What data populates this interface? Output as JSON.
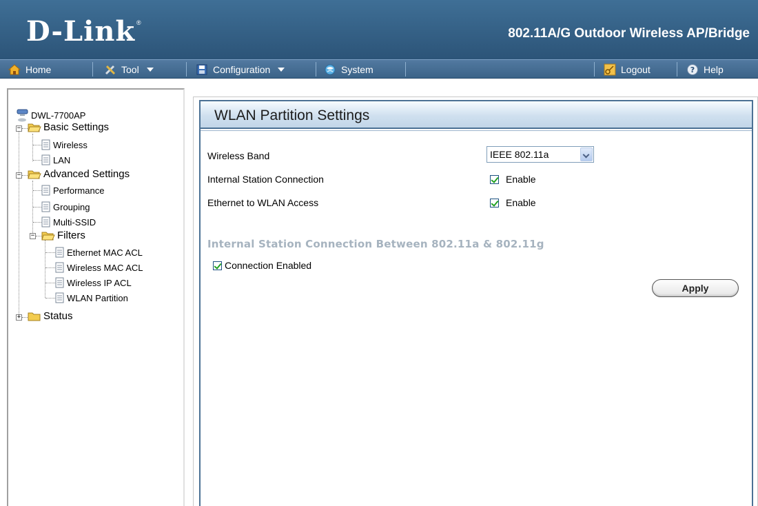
{
  "header": {
    "logo_text": "D-Link",
    "logo_reg": "®",
    "product_title": "802.11A/G Outdoor Wireless AP/Bridge"
  },
  "menu": {
    "home": "Home",
    "tool": "Tool",
    "configuration": "Configuration",
    "system": "System",
    "logout": "Logout",
    "help": "Help"
  },
  "tree": {
    "root": "DWL-7700AP",
    "basic_settings": "Basic Settings",
    "wireless": "Wireless",
    "lan": "LAN",
    "advanced_settings": "Advanced Settings",
    "performance": "Performance",
    "grouping": "Grouping",
    "multi_ssid": "Multi-SSID",
    "filters": "Filters",
    "ethernet_mac_acl": "Ethernet MAC ACL",
    "wireless_mac_acl": "Wireless MAC ACL",
    "wireless_ip_acl": "Wireless IP ACL",
    "wlan_partition": "WLAN Partition",
    "status": "Status"
  },
  "panel": {
    "title": "WLAN Partition Settings",
    "wireless_band_label": "Wireless Band",
    "wireless_band_value": "IEEE 802.11a",
    "internal_station_label": "Internal Station Connection",
    "internal_station_option": "Enable",
    "internal_station_checked": true,
    "ethernet_wlan_label": "Ethernet to WLAN Access",
    "ethernet_wlan_option": "Enable",
    "ethernet_wlan_checked": true,
    "section_heading": "Internal Station Connection Between 802.11a & 802.11g",
    "connection_enabled_label": "Connection Enabled",
    "connection_enabled_checked": true,
    "apply_label": "Apply"
  },
  "colors": {
    "header_bg": "#2f5a80",
    "menubar_bg": "#4670996",
    "panel_title_bg": "#cfe0ef",
    "panel_border": "#4b7194",
    "section_heading": "#a6b3bf",
    "check_mark": "#21a121"
  }
}
